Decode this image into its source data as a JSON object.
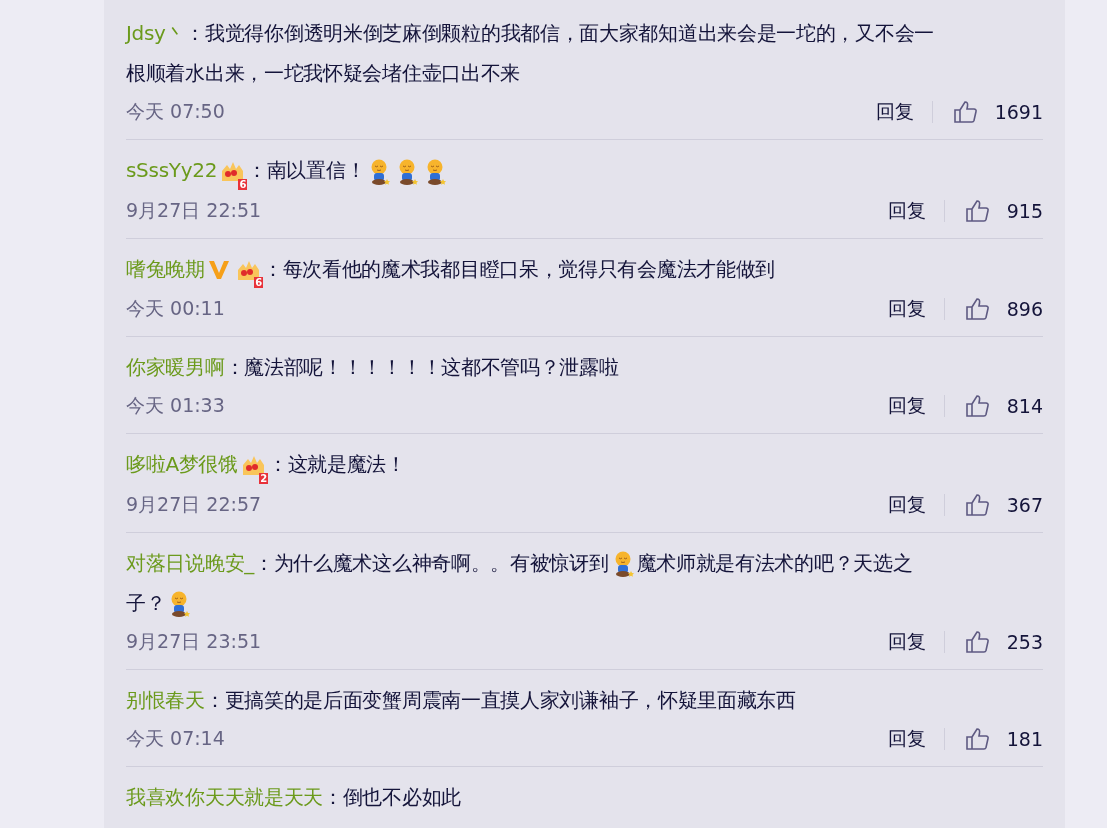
{
  "comments": [
    {
      "user": "Jdsy丶",
      "content": [
        {
          "kind": "text",
          "text": "：我觉得你倒透明米倒芝麻倒颗粒的我都信，面大家都知道出来会是一坨的，又不会一"
        },
        {
          "kind": "break"
        },
        {
          "kind": "text",
          "text": "根顺着水出来，一坨我怀疑会堵住壶口出不来"
        }
      ],
      "time": "今天 07:50",
      "reply": "回复",
      "likes": "1691"
    },
    {
      "user": "sSssYy22",
      "badges": [
        {
          "kind": "crown",
          "label": "6"
        }
      ],
      "content": [
        {
          "kind": "text",
          "text": "：南以置信！"
        },
        {
          "kind": "emoji"
        },
        {
          "kind": "emoji"
        },
        {
          "kind": "emoji"
        }
      ],
      "time": "9月27日 22:51",
      "reply": "回复",
      "likes": "915"
    },
    {
      "user": "嗜兔晚期",
      "badges": [
        {
          "kind": "vip"
        },
        {
          "kind": "crown",
          "label": "6"
        }
      ],
      "content": [
        {
          "kind": "text",
          "text": "：每次看他的魔术我都目瞪口呆，觉得只有会魔法才能做到"
        }
      ],
      "time": "今天 00:11",
      "reply": "回复",
      "likes": "896"
    },
    {
      "user": "你家暖男啊",
      "content": [
        {
          "kind": "text",
          "text": "：魔法部呢！！！！！！这都不管吗？泄露啦"
        }
      ],
      "time": "今天 01:33",
      "reply": "回复",
      "likes": "814"
    },
    {
      "user": "哆啦A梦很饿",
      "badges": [
        {
          "kind": "crown",
          "label": "2"
        }
      ],
      "content": [
        {
          "kind": "text",
          "text": "：这就是魔法！"
        }
      ],
      "time": "9月27日 22:57",
      "reply": "回复",
      "likes": "367"
    },
    {
      "user": "对落日说晚安_",
      "content": [
        {
          "kind": "text",
          "text": "：为什么魔术这么神奇啊。。有被惊讶到"
        },
        {
          "kind": "emoji"
        },
        {
          "kind": "text",
          "text": "魔术师就是有法术的吧？天选之"
        },
        {
          "kind": "break"
        },
        {
          "kind": "text",
          "text": "子？"
        },
        {
          "kind": "emoji"
        }
      ],
      "time": "9月27日 23:51",
      "reply": "回复",
      "likes": "253"
    },
    {
      "user": "别恨春天",
      "content": [
        {
          "kind": "text",
          "text": "：更搞笑的是后面变蟹周震南一直摸人家刘谦袖子，怀疑里面藏东西"
        }
      ],
      "time": "今天 07:14",
      "reply": "回复",
      "likes": "181"
    },
    {
      "user": "我喜欢你天天就是天天",
      "content": [
        {
          "kind": "text",
          "text": "：倒也不必如此"
        }
      ]
    }
  ]
}
